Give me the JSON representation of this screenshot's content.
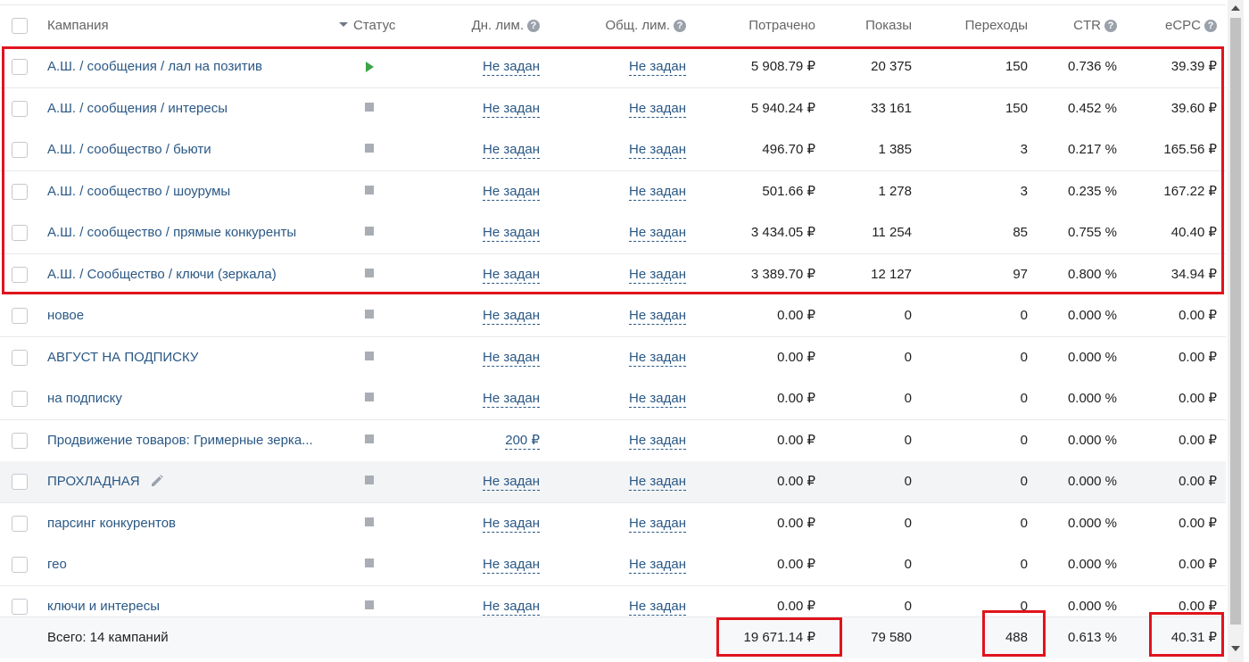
{
  "header": {
    "campaign": "Кампания",
    "status": "Статус",
    "day_limit": "Дн. лим.",
    "total_limit": "Общ. лим.",
    "spent": "Потрачено",
    "shows": "Показы",
    "clicks": "Переходы",
    "ctr": "CTR",
    "ecpc": "eCPC",
    "help_glyph": "?"
  },
  "rows": [
    {
      "name": "А.Ш. / сообщения / лал на позитив",
      "status": "running",
      "day_limit": "Не задан",
      "total_limit": "Не задан",
      "spent": "5 908.79 ₽",
      "shows": "20 375",
      "clicks": "150",
      "ctr": "0.736 %",
      "ecpc": "39.39 ₽"
    },
    {
      "name": "А.Ш. / сообщения / интересы",
      "status": "stopped",
      "day_limit": "Не задан",
      "total_limit": "Не задан",
      "spent": "5 940.24 ₽",
      "shows": "33 161",
      "clicks": "150",
      "ctr": "0.452 %",
      "ecpc": "39.60 ₽"
    },
    {
      "name": "А.Ш. / сообщество / бьюти",
      "status": "stopped",
      "day_limit": "Не задан",
      "total_limit": "Не задан",
      "spent": "496.70 ₽",
      "shows": "1 385",
      "clicks": "3",
      "ctr": "0.217 %",
      "ecpc": "165.56 ₽"
    },
    {
      "name": "А.Ш. / сообщество / шоурумы",
      "status": "stopped",
      "day_limit": "Не задан",
      "total_limit": "Не задан",
      "spent": "501.66 ₽",
      "shows": "1 278",
      "clicks": "3",
      "ctr": "0.235 %",
      "ecpc": "167.22 ₽"
    },
    {
      "name": "А.Ш. / сообщество / прямые конкуренты",
      "status": "stopped",
      "day_limit": "Не задан",
      "total_limit": "Не задан",
      "spent": "3 434.05 ₽",
      "shows": "11 254",
      "clicks": "85",
      "ctr": "0.755 %",
      "ecpc": "40.40 ₽"
    },
    {
      "name": "А.Ш. / Сообщество / ключи (зеркала)",
      "status": "stopped",
      "day_limit": "Не задан",
      "total_limit": "Не задан",
      "spent": "3 389.70 ₽",
      "shows": "12 127",
      "clicks": "97",
      "ctr": "0.800 %",
      "ecpc": "34.94 ₽"
    },
    {
      "name": "новое",
      "status": "stopped",
      "day_limit": "Не задан",
      "total_limit": "Не задан",
      "spent": "0.00 ₽",
      "shows": "0",
      "clicks": "0",
      "ctr": "0.000 %",
      "ecpc": "0.00 ₽"
    },
    {
      "name": "АВГУСТ НА ПОДПИСКУ",
      "status": "stopped",
      "day_limit": "Не задан",
      "total_limit": "Не задан",
      "spent": "0.00 ₽",
      "shows": "0",
      "clicks": "0",
      "ctr": "0.000 %",
      "ecpc": "0.00 ₽"
    },
    {
      "name": "на подписку",
      "status": "stopped",
      "day_limit": "Не задан",
      "total_limit": "Не задан",
      "spent": "0.00 ₽",
      "shows": "0",
      "clicks": "0",
      "ctr": "0.000 %",
      "ecpc": "0.00 ₽"
    },
    {
      "name": "Продвижение товаров: Гримерные зерка...",
      "status": "stopped",
      "day_limit": "200 ₽",
      "total_limit": "Не задан",
      "spent": "0.00 ₽",
      "shows": "0",
      "clicks": "0",
      "ctr": "0.000 %",
      "ecpc": "0.00 ₽"
    },
    {
      "name": "ПРОХЛАДНАЯ",
      "status": "stopped",
      "day_limit": "Не задан",
      "total_limit": "Не задан",
      "spent": "0.00 ₽",
      "shows": "0",
      "clicks": "0",
      "ctr": "0.000 %",
      "ecpc": "0.00 ₽"
    },
    {
      "name": "парсинг конкурентов",
      "status": "stopped",
      "day_limit": "Не задан",
      "total_limit": "Не задан",
      "spent": "0.00 ₽",
      "shows": "0",
      "clicks": "0",
      "ctr": "0.000 %",
      "ecpc": "0.00 ₽"
    },
    {
      "name": "гео",
      "status": "stopped",
      "day_limit": "Не задан",
      "total_limit": "Не задан",
      "spent": "0.00 ₽",
      "shows": "0",
      "clicks": "0",
      "ctr": "0.000 %",
      "ecpc": "0.00 ₽"
    },
    {
      "name": "ключи и интересы",
      "status": "stopped",
      "day_limit": "Не задан",
      "total_limit": "Не задан",
      "spent": "0.00 ₽",
      "shows": "0",
      "clicks": "0",
      "ctr": "0.000 %",
      "ecpc": "0.00 ₽"
    }
  ],
  "footer": {
    "total_label": "Всего: 14 кампаний",
    "spent": "19 671.14 ₽",
    "shows": "79 580",
    "clicks": "488",
    "ctr": "0.613 %",
    "ecpc": "40.31 ₽"
  },
  "colors": {
    "link": "#2a5885",
    "running": "#3ea34a",
    "stopped": "#a9aeb5",
    "highlight": "#e0141d"
  }
}
